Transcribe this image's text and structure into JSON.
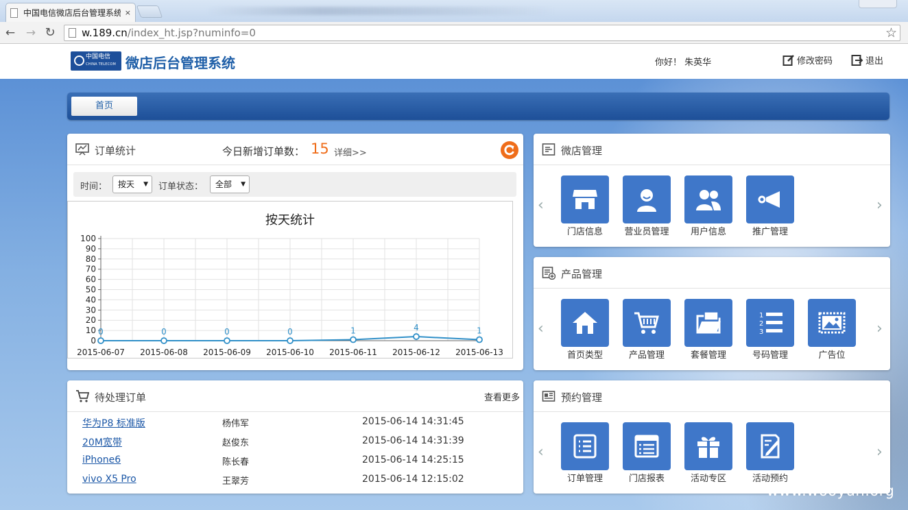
{
  "browser": {
    "tab_title": "中国电信微店后台管理系统",
    "tab_close": "×",
    "url_host": "w.189.cn",
    "url_path": "/index_ht.jsp?numinfo=0"
  },
  "header": {
    "logo_text": "中国电信",
    "logo_subtext": "CHINA TELECOM",
    "title": "微店后台管理系统",
    "greeting": "你好！ 朱英华",
    "change_password": "修改密码",
    "logout": "退出"
  },
  "nav": {
    "home": "首页"
  },
  "orders_panel": {
    "title": "订单统计",
    "today_label": "今日新增订单数：",
    "today_count": "15",
    "detail_link": "详细>>",
    "time_label": "时间：",
    "time_value": "按天",
    "status_label": "订单状态：",
    "status_value": "全部"
  },
  "chart_data": {
    "type": "line",
    "title": "按天统计",
    "categories": [
      "2015-06-07",
      "2015-06-08",
      "2015-06-09",
      "2015-06-10",
      "2015-06-11",
      "2015-06-12",
      "2015-06-13"
    ],
    "series": [
      {
        "values": [
          0,
          0,
          0,
          0,
          1,
          4,
          1
        ]
      }
    ],
    "ylim": [
      0,
      100
    ],
    "yticks": [
      0,
      10,
      20,
      30,
      40,
      50,
      60,
      70,
      80,
      90,
      100
    ],
    "grid": true,
    "color": "#2f8fc8"
  },
  "pending_panel": {
    "title": "待处理订单",
    "more": "查看更多",
    "rows": [
      {
        "product": "华为P8 标准版",
        "name": "杨伟军",
        "time": "2015-06-14 14:31:45"
      },
      {
        "product": "20M宽带",
        "name": "赵俊东",
        "time": "2015-06-14 14:31:39"
      },
      {
        "product": "iPhone6",
        "name": "陈长春",
        "time": "2015-06-14 14:25:15"
      },
      {
        "product": "vivo X5 Pro",
        "name": "王翠芳",
        "time": "2015-06-14 12:15:02"
      }
    ]
  },
  "shop_panel": {
    "title": "微店管理",
    "tiles": [
      {
        "label": "门店信息",
        "icon": "store-icon"
      },
      {
        "label": "营业员管理",
        "icon": "clerk-icon"
      },
      {
        "label": "用户信息",
        "icon": "users-icon"
      },
      {
        "label": "推广管理",
        "icon": "promotion-icon"
      }
    ]
  },
  "product_panel": {
    "title": "产品管理",
    "tiles": [
      {
        "label": "首页类型",
        "icon": "home-icon"
      },
      {
        "label": "产品管理",
        "icon": "cart-icon"
      },
      {
        "label": "套餐管理",
        "icon": "folder-icon"
      },
      {
        "label": "号码管理",
        "icon": "number-list-icon"
      },
      {
        "label": "广告位",
        "icon": "picture-icon"
      }
    ]
  },
  "booking_panel": {
    "title": "预约管理",
    "tiles": [
      {
        "label": "订单管理",
        "icon": "order-list-icon"
      },
      {
        "label": "门店报表",
        "icon": "report-icon"
      },
      {
        "label": "活动专区",
        "icon": "gift-icon"
      },
      {
        "label": "活动预约",
        "icon": "edit-icon"
      }
    ]
  },
  "carousel": {
    "prev": "‹",
    "next": "›"
  },
  "watermark": "www.wooyun.org",
  "colors": {
    "accent": "#3f77c9",
    "brand": "#1f5fa8",
    "highlight": "#ef6d1a",
    "navbar": "#1d4f98"
  }
}
